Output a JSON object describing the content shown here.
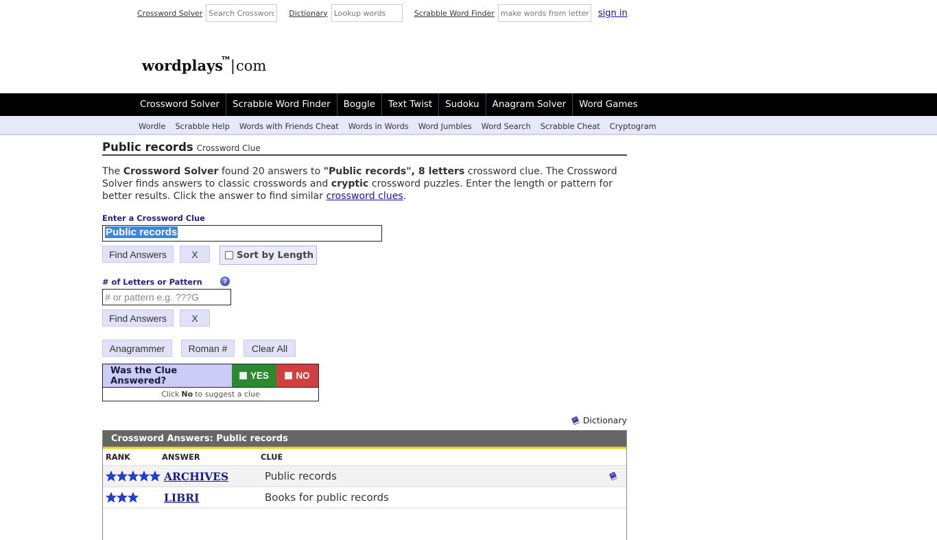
{
  "top_bar": {
    "crossword_solver_link": "Crossword Solver",
    "crossword_search_placeholder": "Search Crosswords",
    "dictionary_link": "Dictionary",
    "dictionary_placeholder": "Lookup words",
    "scrabble_link": "Scrabble Word Finder",
    "scrabble_placeholder": "make words from letters",
    "sign_in": "sign in"
  },
  "logo": {
    "word": "wordplays",
    "tm": "TM",
    "separator": "|",
    "suffix": "com"
  },
  "main_nav": [
    {
      "label": "Crossword Solver"
    },
    {
      "label": "Scrabble Word Finder"
    },
    {
      "label": "Boggle"
    },
    {
      "label": "Text Twist"
    },
    {
      "label": "Sudoku"
    },
    {
      "label": "Anagram Solver"
    },
    {
      "label": "Word Games"
    }
  ],
  "sub_nav": [
    {
      "label": "Wordle"
    },
    {
      "label": "Scrabble Help"
    },
    {
      "label": "Words with Friends Cheat"
    },
    {
      "label": "Words in Words"
    },
    {
      "label": "Word Jumbles"
    },
    {
      "label": "Word Search"
    },
    {
      "label": "Scrabble Cheat"
    },
    {
      "label": "Cryptogram"
    }
  ],
  "page": {
    "title": "Public records",
    "title_suffix": "Crossword Clue",
    "intro": {
      "t1": "The ",
      "b1": "Crossword Solver",
      "t2": " found 20 answers to ",
      "b2": "\"Public records\", 8 letters",
      "t3": " crossword clue. The Crossword Solver finds answers to classic crosswords and ",
      "b3": "cryptic",
      "t4": " crossword puzzles. Enter the length or pattern for better results. Click the answer to find similar ",
      "link": "crossword clues",
      "t5": "."
    }
  },
  "form": {
    "clue_label": "Enter a Crossword Clue",
    "clue_value": "Public records",
    "find_answers": "Find Answers",
    "clear": "X",
    "sort_by_length": "Sort by Length",
    "sort_checked": false,
    "pattern_label": "# of Letters or Pattern",
    "pattern_placeholder": "# or pattern e.g. ???G",
    "help": "?",
    "anagrammer": "Anagrammer",
    "roman": "Roman #",
    "clear_all": "Clear All"
  },
  "feedback": {
    "question": "Was the Clue Answered?",
    "yes": "YES",
    "no": "NO",
    "hint_pre": "Click",
    "hint_bold": "No",
    "hint_post": "to suggest a clue"
  },
  "dictionary_link": "Dictionary",
  "answers": {
    "header": "Crossword Answers: Public records",
    "columns": [
      "RANK",
      "ANSWER",
      "CLUE"
    ],
    "rows": [
      {
        "rank_stars": 5,
        "answer": "ARCHIVES",
        "clue": "Public records",
        "has_dictionary": true
      },
      {
        "rank_stars": 3,
        "answer": "LIBRI",
        "clue": "Books for public records",
        "has_dictionary": false
      }
    ]
  },
  "colors": {
    "nav_bg": "#000000",
    "subnav_bg": "#e8e8fb",
    "answers_header_bg": "#666666",
    "answers_header_accent": "#f0d000",
    "yes_green": "#2b8a2f",
    "no_red": "#d23f3f",
    "star_blue": "#1f3fe0"
  }
}
